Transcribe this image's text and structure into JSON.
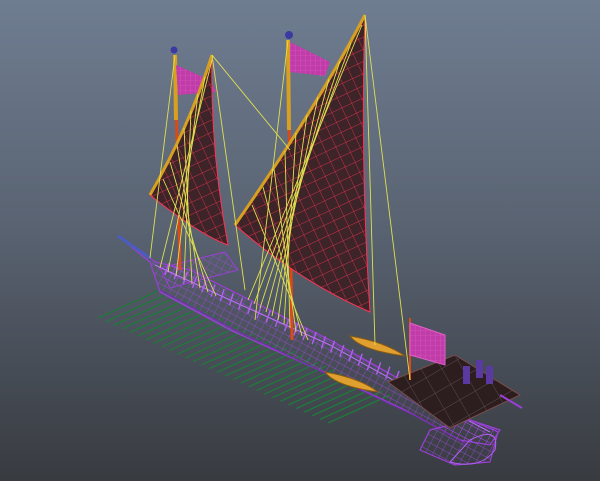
{
  "viewport": {
    "view": "perspective",
    "display_mode": "wireframe",
    "subject": "galley-ship-model",
    "background_top": "#6f7d91",
    "background_bottom": "#383b40"
  },
  "colors": {
    "hull_wire": "#9a3fd8",
    "sail_fill": "#3d2428",
    "sail_wire": "#ff3355",
    "flag": "#c03ca8",
    "mast": "#d84a18",
    "mast_top": "#d8a020",
    "rigging": "#e0e050",
    "oars": "#1f7a3a",
    "boat": "#e0a030",
    "deck": "#2c1e1f"
  },
  "icons": [
    "mast-finial-icon"
  ]
}
